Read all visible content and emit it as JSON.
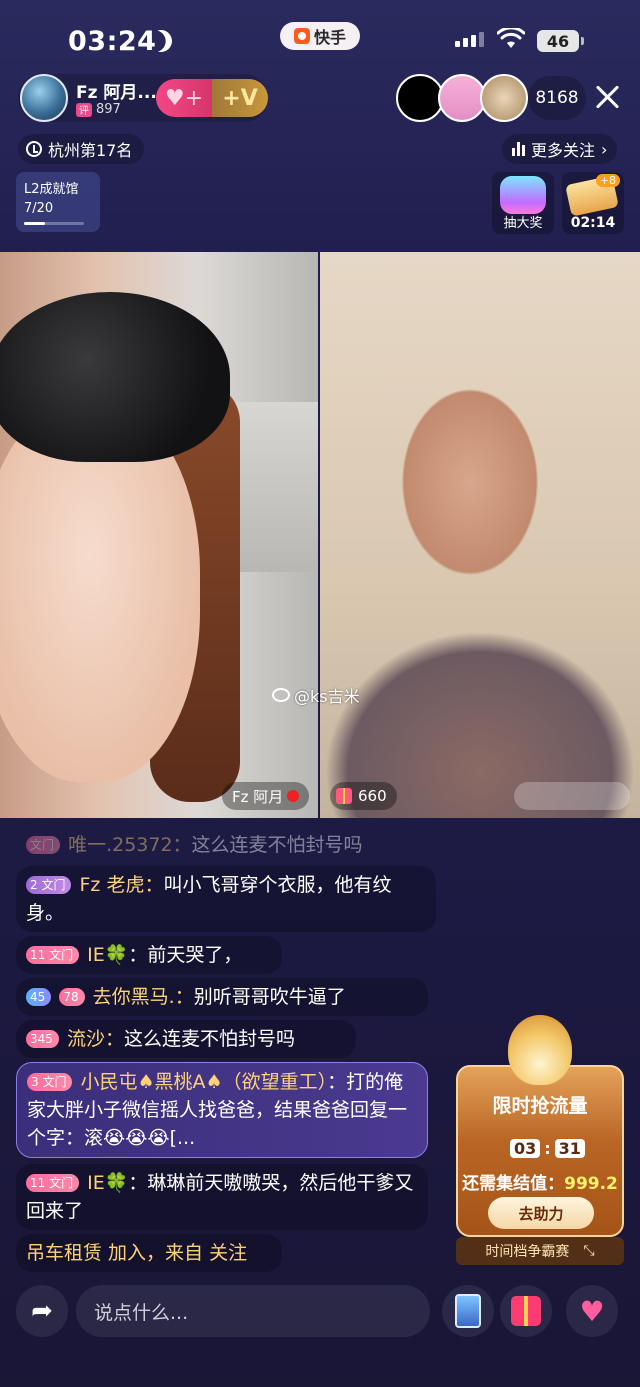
{
  "status_bar": {
    "time": "03:24",
    "app_pill": "快手",
    "battery": "46"
  },
  "host": {
    "name": "Fz 阿月...",
    "badge_icon": "评",
    "fans": "897",
    "follow_plus": "+",
    "vip_plus": "+V"
  },
  "viewers": {
    "count": "8168"
  },
  "rank": {
    "label": "杭州第17名"
  },
  "more_follow": {
    "label": "更多关注"
  },
  "level": {
    "title": "L2成就馆",
    "progress": "7/20",
    "progress_fraction": 0.35
  },
  "lottery": {
    "label": "抽大奖"
  },
  "chest": {
    "plus": "+8",
    "timer": "02:14"
  },
  "video": {
    "host_tag": "Fz 阿月",
    "gift_count": "660",
    "watermark": "@ks吉米"
  },
  "chat": [
    {
      "badge": "文门",
      "nick": "唯一.25372：",
      "text": "这么连麦不怕封号吗"
    },
    {
      "badge": "2 文门",
      "nick": "Fz  老虎：",
      "text": "叫小飞哥穿个衣服，他有纹身。"
    },
    {
      "badge": "11 文门",
      "nick": "IE",
      "clover": "🍀",
      "text": "：前天哭了，"
    },
    {
      "badge1": "45",
      "badge2": "78",
      "nick": "去你黑马.：",
      "text": "别听哥哥吹牛逼了"
    },
    {
      "badge": "345",
      "nick": "流沙：",
      "text": "这么连麦不怕封号吗"
    },
    {
      "badge": "3 文门",
      "nick": "小民屯♠黑桃A♠（欲望重工）",
      "text": "：打的俺家大胖小子微信摇人找爸爸，结果爸爸回复一个字：滚😭😭😭[..."
    },
    {
      "badge": "11 文门",
      "nick": "IE",
      "clover": "🍀",
      "text": "：琳琳前天嗷嗷哭，然后他干爹又回来了"
    },
    {
      "text": "吊车租赁 加入，来自 关注"
    }
  ],
  "promo": {
    "title": "限时抢流量",
    "timer_m": "03",
    "timer_s": "31",
    "need_label": "还需集结值：",
    "need_value": "999.2",
    "button": "去助力",
    "footer": "时间档争霸赛"
  },
  "bottom": {
    "placeholder": "说点什么..."
  }
}
